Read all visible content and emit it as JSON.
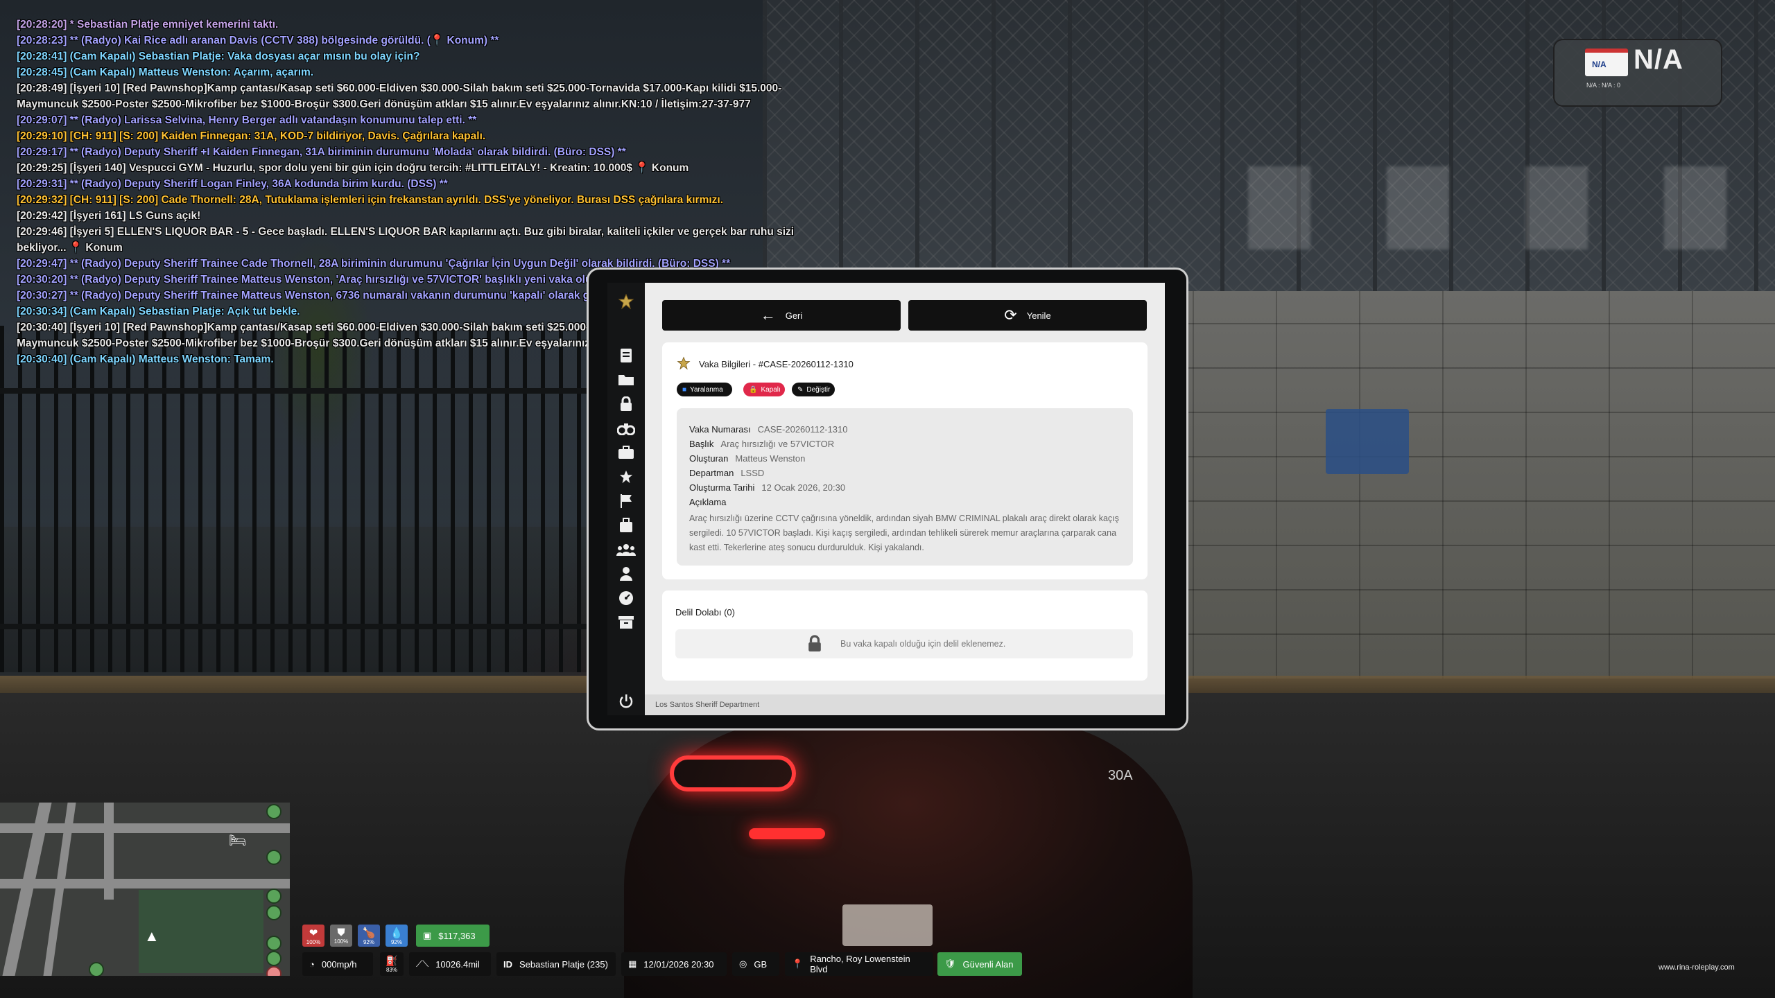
{
  "chat": [
    {
      "text": "[20:28:20] * Sebastian Platje emniyet kemerini taktı.",
      "color": "#c3a2e6"
    },
    {
      "text": "[20:28:23] ** (Radyo) Kai Rice adlı aranan Davis (CCTV 388) bölgesinde görüldü. (📍 Konum) **",
      "color": "#a3a3ff"
    },
    {
      "text": "[20:28:41] (Cam Kapalı) Sebastian Platje: Vaka dosyası açar mısın bu olay için?",
      "color": "#7fd6ff"
    },
    {
      "text": "[20:28:45] (Cam Kapalı) Matteus Wenston: Açarım, açarım.",
      "color": "#7fd6ff"
    },
    {
      "text": "[20:28:49] [İşyeri 10] [Red Pawnshop]Kamp çantası/Kasap seti $60.000-Eldiven $30.000-Silah bakım seti $25.000-Tornavida $17.000-Kapı kilidi $15.000-\nMaymuncuk $2500-Poster $2500-Mikrofiber bez $1000-Broşür $300.Geri dönüşüm atkları $15 alınır.Ev eşyalarınız alınır.KN:10 / İletişim:27-37-977",
      "color": "#e8e8e8"
    },
    {
      "text": "[20:29:07] ** (Radyo) Larissa Selvina, Henry Berger adlı vatandaşın konumunu talep etti. **",
      "color": "#a3a3ff"
    },
    {
      "text": "[20:29:10] [CH: 911] [S: 200] Kaiden Finnegan: 31A, KOD-7 bildiriyor, Davis. Çağrılara kapalı.",
      "color": "#ffc233"
    },
    {
      "text": "[20:29:17] ** (Radyo) Deputy Sheriff +I Kaiden Finnegan, 31A biriminin durumunu 'Molada' olarak bildirdi. (Büro: DSS) **",
      "color": "#a3a3ff"
    },
    {
      "text": "[20:29:25] [İşyeri 140] Vespucci GYM - Huzurlu, spor dolu yeni bir gün için doğru tercih: #LITTLEITALY! - Kreatin: 10.000$ 📍 Konum",
      "color": "#e8e8e8"
    },
    {
      "text": "[20:29:31] ** (Radyo) Deputy Sheriff Logan Finley, 36A kodunda birim kurdu. (DSS) **",
      "color": "#a3a3ff"
    },
    {
      "text": "[20:29:32] [CH: 911] [S: 200] Cade Thornell: 28A, Tutuklama işlemleri için frekanstan ayrıldı. DSS'ye yöneliyor. Burası DSS çağrılara kırmızı.",
      "color": "#ffc233"
    },
    {
      "text": "[20:29:42] [İşyeri 161] LS Guns açık!",
      "color": "#e8e8e8"
    },
    {
      "text": "[20:29:46] [İşyeri 5] ELLEN'S LIQUOR BAR - 5 - Gece başladı. ELLEN'S LIQUOR BAR kapılarını açtı. Buz gibi biralar, kaliteli içkiler ve gerçek bar ruhu sizi\nbekliyor... 📍 Konum",
      "color": "#e8e8e8"
    },
    {
      "text": "[20:29:47] ** (Radyo) Deputy Sheriff Trainee Cade Thornell, 28A biriminin durumunu 'Çağrılar İçin Uygun Değil' olarak bildirdi. (Büro: DSS) **",
      "color": "#a3a3ff"
    },
    {
      "text": "[20:30:20] ** (Radyo) Deputy Sheriff Trainee Matteus Wenston, 'Araç hırsızlığı ve 57VICTOR' başlıklı yeni vaka oluşturdu.",
      "color": "#a3a3ff"
    },
    {
      "text": "[20:30:27] ** (Radyo) Deputy Sheriff Trainee Matteus Wenston, 6736 numaralı vakanın durumunu 'kapalı' olarak güncelledi.",
      "color": "#a3a3ff"
    },
    {
      "text": "[20:30:34] (Cam Kapalı) Sebastian Platje: Açık tut bekle.",
      "color": "#7fd6ff"
    },
    {
      "text": "[20:30:40] [İşyeri 10] [Red Pawnshop]Kamp çantası/Kasap seti $60.000-Eldiven $30.000-Silah bakım seti $25.000-Tornavida $17.000-Kapı kilidi $15.000-\nMaymuncuk $2500-Poster $2500-Mikrofiber bez $1000-Broşür $300.Geri dönüşüm atkları $15 alınır.Ev eşyalarınız alınır.KN:10 / İletişim:27-37-977",
      "color": "#e8e8e8"
    },
    {
      "text": "[20:30:40] (Cam Kapalı) Matteus Wenston: Tamam.",
      "color": "#7fd6ff"
    }
  ],
  "plate": {
    "mini": "N/A",
    "big": "N/A",
    "sub": "N/A : N/A : 0"
  },
  "tablet": {
    "back_label": "Geri",
    "refresh_label": "Yenile",
    "case_title": "Vaka Bilgileri - #CASE-20260112-1310",
    "badges": {
      "vehicle": "Yaralanma",
      "locked": "Kapalı",
      "edit": "Değiştir"
    },
    "fields": [
      {
        "k": "Vaka Numarası",
        "v": "CASE-20260112-1310"
      },
      {
        "k": "Başlık",
        "v": "Araç hırsızlığı ve 57VICTOR"
      },
      {
        "k": "Oluşturan",
        "v": "Matteus Wenston"
      },
      {
        "k": "Departman",
        "v": "LSSD"
      },
      {
        "k": "Oluşturma Tarihi",
        "v": "12 Ocak 2026, 20:30"
      }
    ],
    "desc_label": "Açıklama",
    "desc": "Araç hırsızlığı üzerine CCTV çağrısına yöneldik, ardından siyah BMW CRIMINAL plakalı araç direkt olarak kaçış sergiledi. 10 57VICTOR başladı. Kişi kaçış sergiledi, ardından tehlikeli sürerek memur araçlarına çarparak cana kast etti. Tekerlerine ateş sonucu durdurulduk. Kişi yakalandı.",
    "evidence_title": "Delil Dolabı (0)",
    "evidence_empty": "Bu vaka kapalı olduğu için delil eklenemez.",
    "footer": "Los Santos Sheriff Department"
  },
  "scene": {
    "spot_label": "30A"
  },
  "hud": {
    "health": "100%",
    "armor": "100%",
    "hunger": "92%",
    "thirst": "92%",
    "money": "$117,363",
    "speed": "000mp/h",
    "fuel": "83%",
    "odometer": "10026.4mil",
    "id_label": "ID",
    "player": "Sebastian Platje (235)",
    "datetime": "12/01/2026 20:30",
    "radio": "GB",
    "location": "Rancho, Roy Lowenstein Blvd",
    "zone": "Güvenli Alan"
  },
  "brand": "www.rina-roleplay.com"
}
